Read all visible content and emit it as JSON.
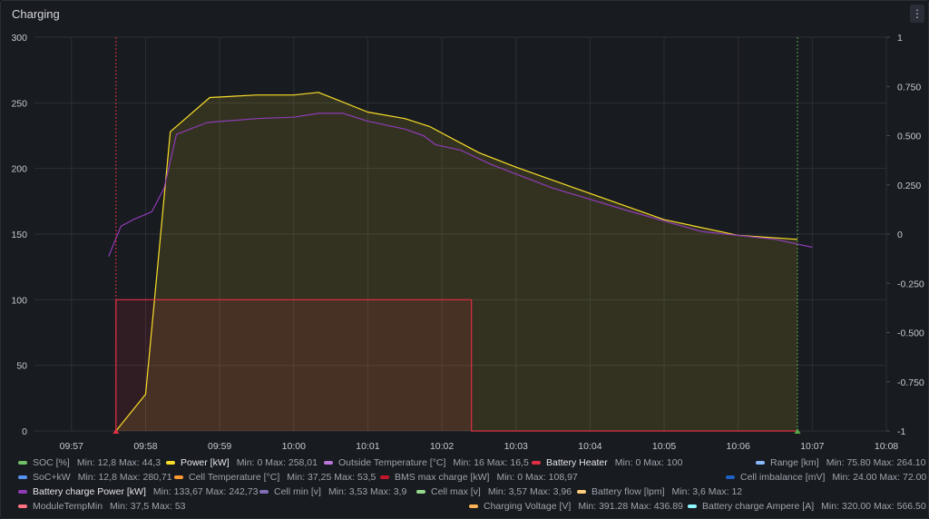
{
  "panel": {
    "title": "Charging",
    "menu_icon": "⋮"
  },
  "chart_data": {
    "type": "line",
    "xlabel": "",
    "ylabel": "",
    "grid": true,
    "x_ticks": [
      "09:57",
      "09:58",
      "09:59",
      "10:00",
      "10:01",
      "10:02",
      "10:03",
      "10:04",
      "10:05",
      "10:06",
      "10:07",
      "10:08"
    ],
    "x_range": [
      "09:56:30",
      "10:08"
    ],
    "y_left_range": [
      0,
      300
    ],
    "y_left_ticks": [
      "0",
      "50",
      "100",
      "150",
      "200",
      "250",
      "300"
    ],
    "y_right_range": [
      -1,
      1
    ],
    "y_right_ticks": [
      "-1",
      "-0.750",
      "-0.500",
      "-0.250",
      "0",
      "0.250",
      "0.500",
      "0.750",
      "1"
    ],
    "annotations": [
      {
        "time": "09:57:36",
        "color": "#e02f44"
      },
      {
        "time": "10:06:48",
        "color": "#56a64b"
      }
    ],
    "series": [
      {
        "name": "Power [kW]",
        "color": "#fade2a",
        "fill": true,
        "x": [
          "09:57:36",
          "09:58:00",
          "09:58:20",
          "09:58:52",
          "09:59:30",
          "10:00:00",
          "10:00:20",
          "10:01:00",
          "10:01:30",
          "10:01:50",
          "10:02:30",
          "10:03:00",
          "10:04:00",
          "10:05:00",
          "10:06:00",
          "10:06:48"
        ],
        "values": [
          0,
          28,
          228,
          254,
          256,
          256,
          258,
          243,
          238,
          232,
          212,
          201,
          181,
          161,
          149,
          146
        ]
      },
      {
        "name": "Battery charge Power [kW]",
        "color": "#8f3bb8",
        "fill": false,
        "x": [
          "09:57:30",
          "09:57:40",
          "09:57:50",
          "09:58:05",
          "09:58:15",
          "09:58:25",
          "09:58:50",
          "09:59:30",
          "10:00:00",
          "10:00:20",
          "10:00:40",
          "10:01:00",
          "10:01:30",
          "10:01:45",
          "10:01:55",
          "10:02:15",
          "10:02:40",
          "10:03:30",
          "10:04:30",
          "10:05:30",
          "10:06:30",
          "10:07:00"
        ],
        "values": [
          133,
          156,
          161,
          167,
          185,
          226,
          235,
          238,
          239,
          242,
          242,
          236,
          230,
          225,
          218,
          214,
          203,
          185,
          168,
          152,
          146,
          140
        ]
      },
      {
        "name": "Battery Heater",
        "color": "#e02f44",
        "fill": true,
        "step": true,
        "x": [
          "09:57:36",
          "09:57:36",
          "10:02:24",
          "10:02:24",
          "10:06:48"
        ],
        "values": [
          0,
          100,
          100,
          0,
          0
        ]
      }
    ]
  },
  "legend": {
    "rows": [
      [
        {
          "name": "SOC [%]",
          "color": "#73bf69",
          "on": false,
          "stats": "Min: 12,8   Max: 44,3"
        },
        {
          "name": "Power [kW]",
          "color": "#fade2a",
          "on": true,
          "stats": "Min: 0   Max: 258,01"
        },
        {
          "name": "Outside Temperature [°C]",
          "color": "#b877d9",
          "on": false,
          "stats": "Min: 16   Max: 16,5"
        },
        {
          "name": "Battery Heater",
          "color": "#e02f44",
          "on": true,
          "stats": "Min: 0   Max: 100"
        },
        {
          "name": "Range [km]",
          "color": "#8ab8ff",
          "on": false,
          "stats": "Min: 75.80   Max: 264.10"
        }
      ],
      [
        {
          "name": "SoC+kW",
          "color": "#5794f2",
          "on": false,
          "stats": "Min: 12,8   Max: 280,71"
        },
        {
          "name": "Cell Temperature [°C]",
          "color": "#ff9830",
          "on": false,
          "stats": "Min: 37,25   Max: 53,5"
        },
        {
          "name": "BMS max charge [kW]",
          "color": "#c4162a",
          "on": false,
          "stats": "Min: 0   Max: 108,97"
        },
        {
          "name": "Cell imbalance [mV]",
          "color": "#1f60c4",
          "on": false,
          "stats": "Min: 24.00   Max: 72.00"
        }
      ],
      [
        {
          "name": "Battery charge Power [kW]",
          "color": "#8f3bb8",
          "on": true,
          "stats": "Min: 133,67   Max: 242,73"
        },
        {
          "name": "Cell min [v]",
          "color": "#806eb7",
          "on": false,
          "stats": "Min: 3,53   Max: 3,9"
        },
        {
          "name": "Cell max [v]",
          "color": "#96d98d",
          "on": false,
          "stats": "Min: 3,57   Max: 3,96"
        },
        {
          "name": "Battery flow [lpm]",
          "color": "#ffcb7d",
          "on": false,
          "stats": "Min: 3,6   Max: 12"
        }
      ],
      [
        {
          "name": "ModuleTempMin",
          "color": "#ff7383",
          "on": false,
          "stats": "Min: 37,5   Max: 53"
        },
        {
          "name": "Charging Voltage [V]",
          "color": "#ffb357",
          "on": false,
          "stats": "Min: 391.28   Max: 436.89"
        },
        {
          "name": "Battery charge Ampere [A]",
          "color": "#8ff5ff",
          "on": false,
          "stats": "Min: 320.00   Max: 566.50"
        }
      ]
    ]
  }
}
